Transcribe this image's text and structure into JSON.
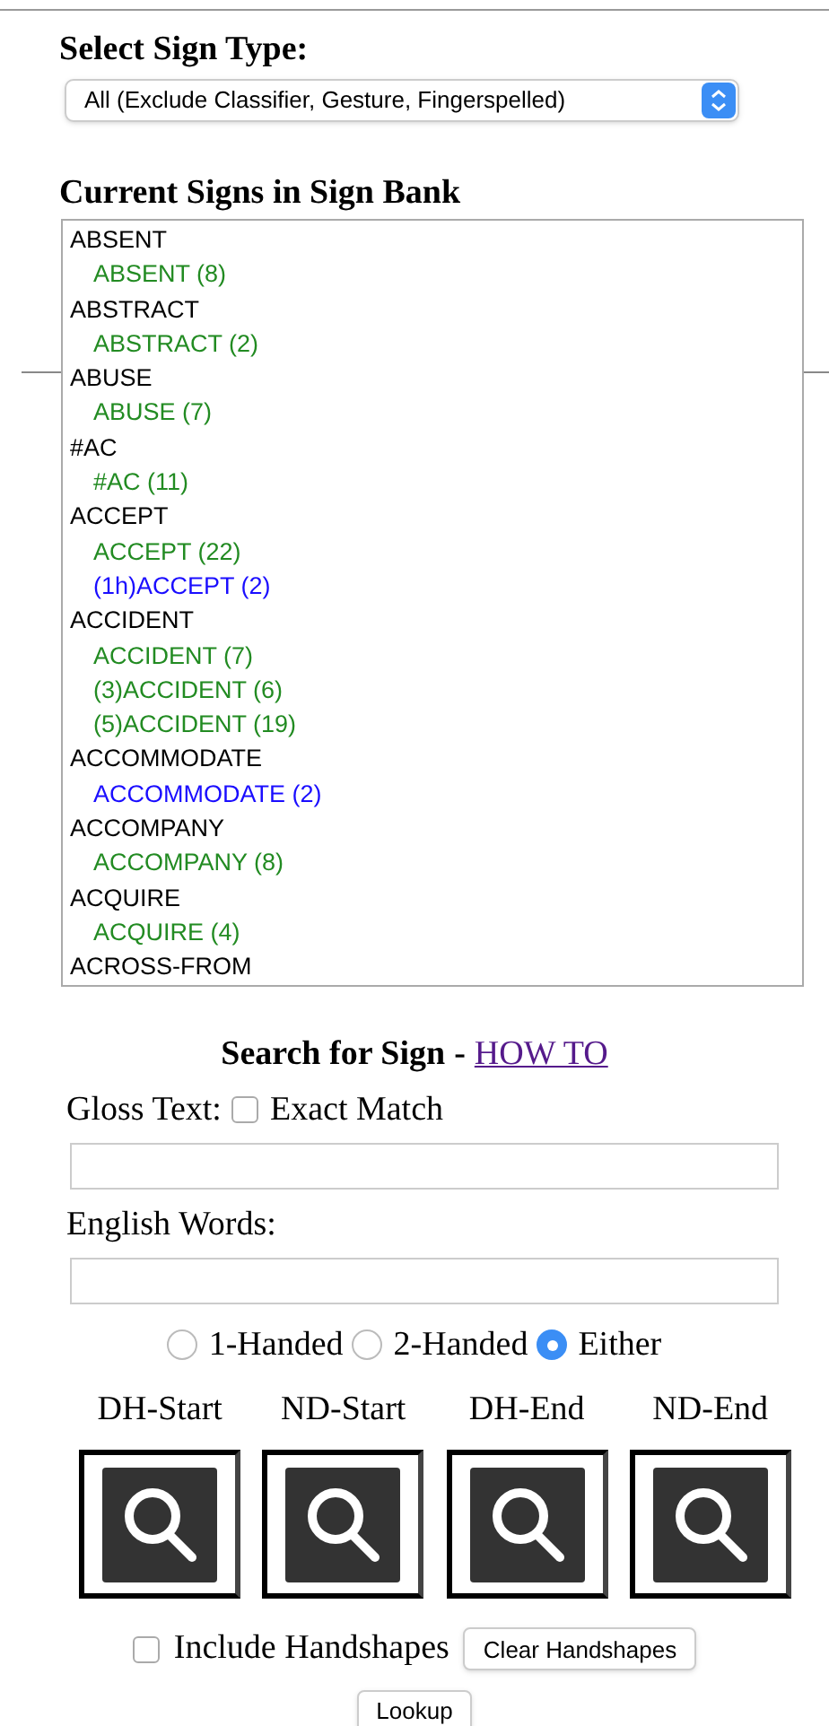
{
  "sign_type": {
    "label": "Select Sign Type:",
    "value": "All (Exclude Classifier, Gesture, Fingerspelled)"
  },
  "sign_bank": {
    "title": "Current Signs in Sign Bank",
    "items": [
      {
        "label": "ABSENT",
        "children": [
          {
            "label": "ABSENT (8)",
            "color": "#228b22"
          }
        ]
      },
      {
        "label": "ABSTRACT",
        "children": [
          {
            "label": "ABSTRACT (2)",
            "color": "#228b22"
          }
        ]
      },
      {
        "label": "ABUSE",
        "children": [
          {
            "label": "ABUSE (7)",
            "color": "#228b22"
          }
        ]
      },
      {
        "label": "#AC",
        "children": [
          {
            "label": "#AC (11)",
            "color": "#228b22"
          }
        ]
      },
      {
        "label": "ACCEPT",
        "children": [
          {
            "label": "ACCEPT (22)",
            "color": "#228b22"
          },
          {
            "label": "(1h)ACCEPT (2)",
            "color": "#1a0dff"
          }
        ]
      },
      {
        "label": "ACCIDENT",
        "children": [
          {
            "label": "ACCIDENT (7)",
            "color": "#228b22"
          },
          {
            "label": "(3)ACCIDENT (6)",
            "color": "#228b22"
          },
          {
            "label": "(5)ACCIDENT (19)",
            "color": "#228b22"
          }
        ]
      },
      {
        "label": "ACCOMMODATE",
        "children": [
          {
            "label": "ACCOMMODATE (2)",
            "color": "#1a0dff"
          }
        ]
      },
      {
        "label": "ACCOMPANY",
        "children": [
          {
            "label": "ACCOMPANY (8)",
            "color": "#228b22"
          }
        ]
      },
      {
        "label": "ACQUIRE",
        "children": [
          {
            "label": "ACQUIRE (4)",
            "color": "#228b22"
          }
        ]
      },
      {
        "label": "ACROSS-FROM"
      }
    ]
  },
  "search": {
    "title": "Search for Sign",
    "separator": "-",
    "link": "HOW TO",
    "gloss_label": "Gloss Text:",
    "exact_match": {
      "label": "Exact Match",
      "checked": false
    },
    "english_label": "English Words:",
    "hands": [
      {
        "label": "1-Handed",
        "selected": false
      },
      {
        "label": "2-Handed",
        "selected": false
      },
      {
        "label": "Either",
        "selected": true
      }
    ],
    "handshapes": [
      "DH-Start",
      "ND-Start",
      "DH-End",
      "ND-End"
    ],
    "include_handshapes": {
      "label": "Include Handshapes",
      "checked": false
    },
    "clear_button": "Clear Handshapes",
    "lookup_button": "Lookup"
  }
}
